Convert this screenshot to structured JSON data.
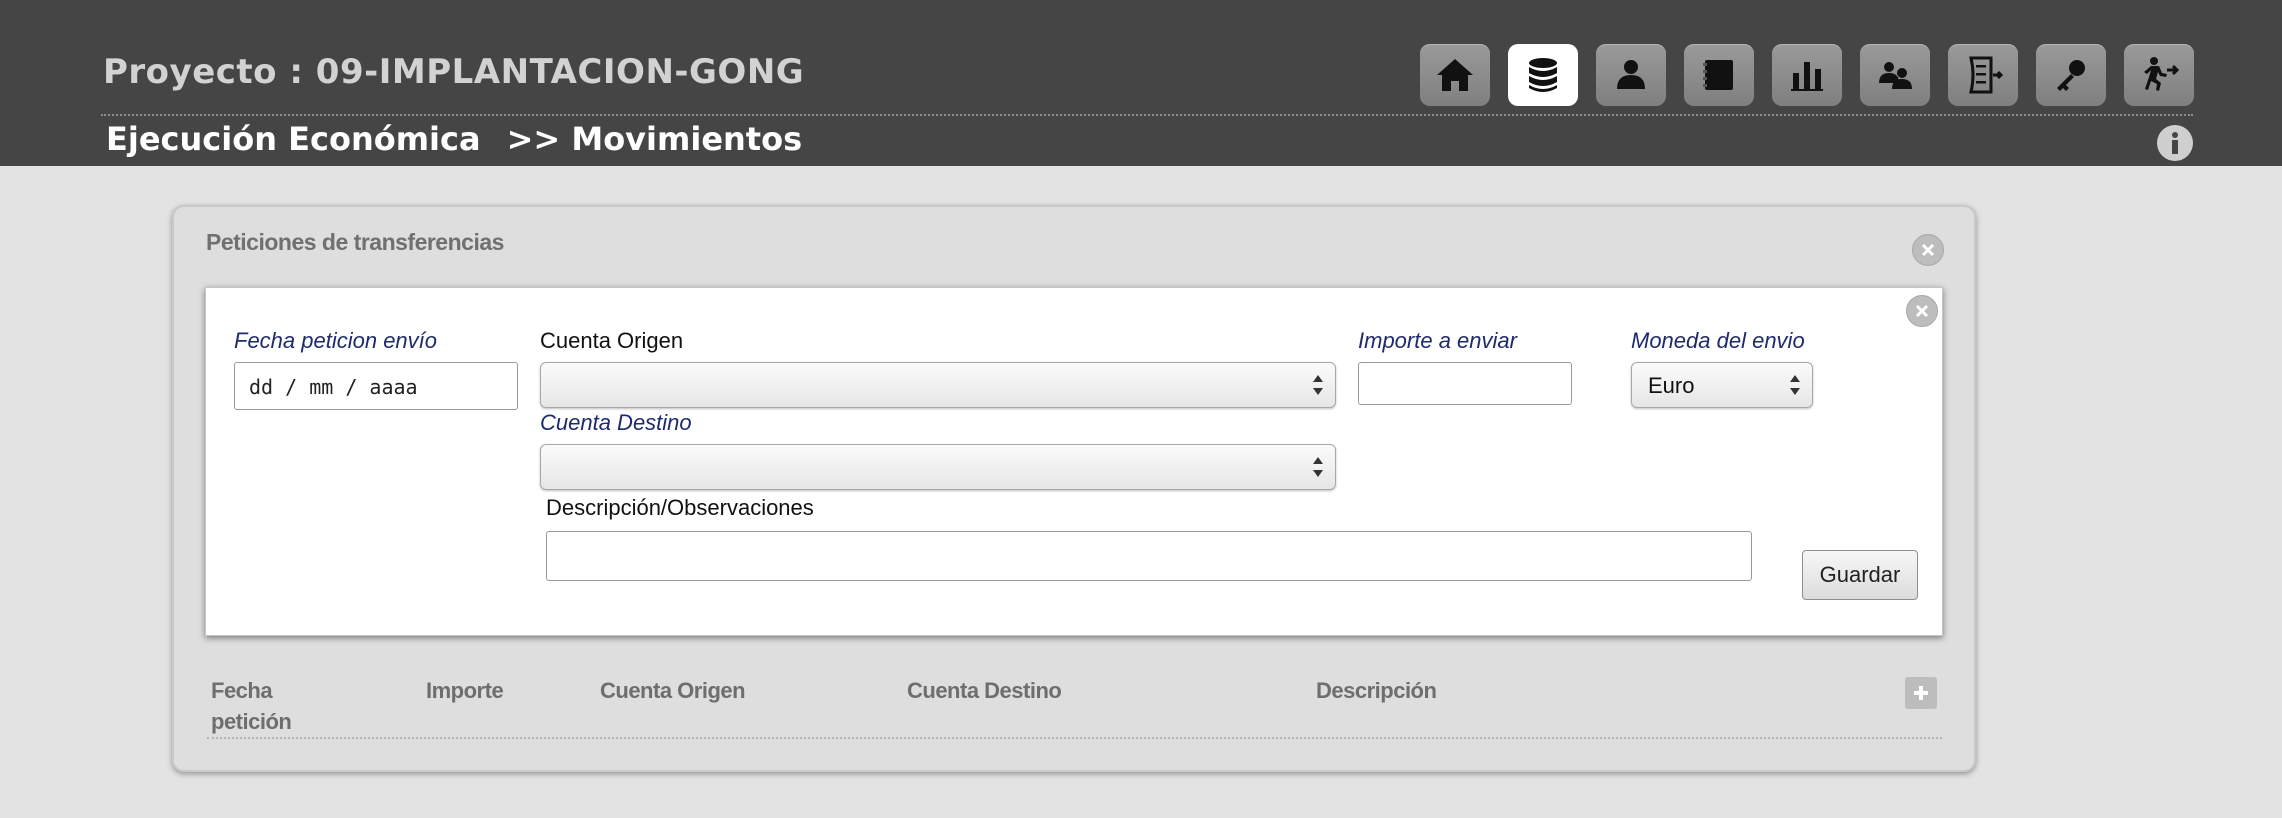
{
  "header": {
    "project_title": "Proyecto : 09-IMPLANTACION-GONG",
    "section": "Ejecución Económica",
    "subsection": ">> Movimientos",
    "nav_icons": [
      "home-icon",
      "database-icon",
      "user-icon",
      "book-icon",
      "bar-chart-icon",
      "users-icon",
      "checklist-icon",
      "key-icon",
      "exit-icon"
    ],
    "active_nav": "database-icon"
  },
  "panel": {
    "title": "Peticiones de transferencias",
    "form": {
      "fecha_label": "Fecha peticion envío",
      "fecha_placeholder": "dd / mm / aaaa",
      "cuenta_origen_label": "Cuenta Origen",
      "cuenta_origen_value": "",
      "cuenta_destino_label": "Cuenta Destino",
      "cuenta_destino_value": "",
      "importe_label": "Importe a enviar",
      "importe_value": "",
      "moneda_label": "Moneda del envio",
      "moneda_value": "Euro",
      "descripcion_label": "Descripción/Observaciones",
      "descripcion_value": "",
      "save_label": "Guardar"
    },
    "table": {
      "columns": [
        "Fecha petición",
        "Importe",
        "Cuenta Origen",
        "Cuenta Destino",
        "Descripción"
      ],
      "rows": []
    }
  },
  "colors": {
    "header_bg": "#454545",
    "page_bg": "#e3e3e3",
    "required_label": "#1d2b6e"
  }
}
